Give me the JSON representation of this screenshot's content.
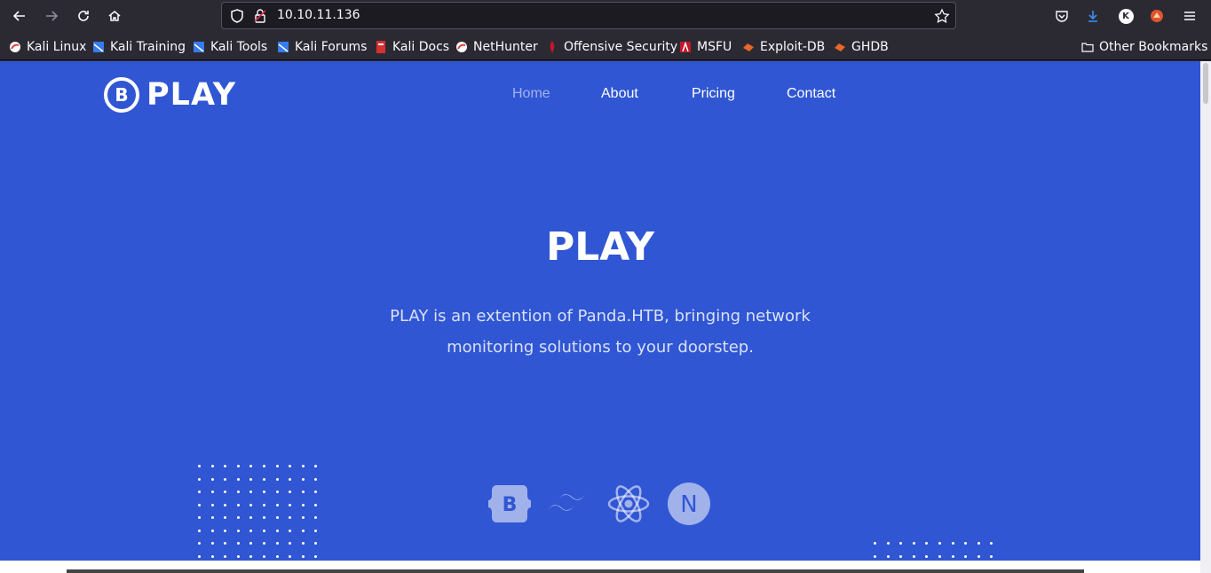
{
  "browser": {
    "url": "10.10.11.136",
    "bookmarks": [
      {
        "label": "Kali Linux",
        "icon": "kali-dragon-icon",
        "color": "#e03e3e"
      },
      {
        "label": "Kali Training",
        "icon": "kali-training-icon",
        "color": "#367bf0"
      },
      {
        "label": "Kali Tools",
        "icon": "kali-tools-icon",
        "color": "#367bf0"
      },
      {
        "label": "Kali Forums",
        "icon": "kali-forums-icon",
        "color": "#367bf0"
      },
      {
        "label": "Kali Docs",
        "icon": "kali-docs-icon",
        "color": "#d63030"
      },
      {
        "label": "NetHunter",
        "icon": "nethunter-icon",
        "color": "#e03e3e"
      },
      {
        "label": "Offensive Security",
        "icon": "offsec-icon",
        "color": "#c4162a"
      },
      {
        "label": "MSFU",
        "icon": "msfu-icon",
        "color": "#c4162a"
      },
      {
        "label": "Exploit-DB",
        "icon": "exploit-db-icon",
        "color": "#e8662a"
      },
      {
        "label": "GHDB",
        "icon": "ghdb-icon",
        "color": "#e8662a"
      }
    ],
    "other_bookmarks": "Other Bookmarks",
    "profile_initial": "K"
  },
  "site": {
    "logo_letter": "B",
    "logo_text": "PLAY",
    "nav": [
      {
        "label": "Home",
        "active": true
      },
      {
        "label": "About",
        "active": false
      },
      {
        "label": "Pricing",
        "active": false
      },
      {
        "label": "Contact",
        "active": false
      }
    ],
    "hero_title": "PLAY",
    "hero_subtitle": "PLAY is an extention of Panda.HTB, bringing network monitoring solutions to your doorstep.",
    "tech_icons": [
      "bootstrap-icon",
      "tailwind-icon",
      "react-icon",
      "nextjs-icon"
    ],
    "nextjs_letter": "N",
    "bootstrap_letter": "B",
    "colors": {
      "brand_blue": "#3056d3",
      "white": "#ffffff"
    }
  }
}
